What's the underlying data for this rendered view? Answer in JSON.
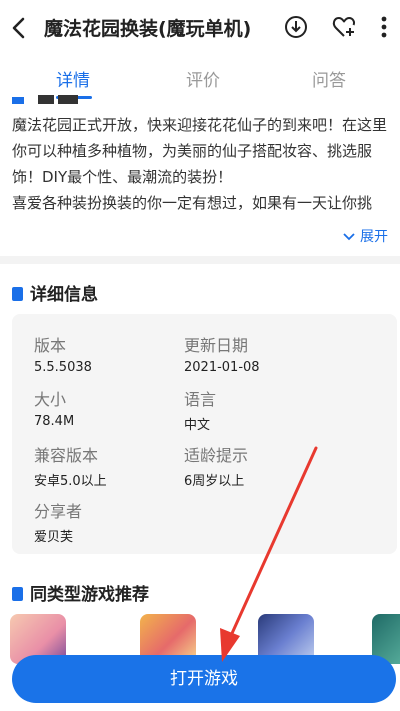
{
  "header": {
    "title": "魔法花园换装(魔玩单机)",
    "icons": [
      "back-icon",
      "download-icon",
      "favorite-add-icon",
      "more-icon"
    ]
  },
  "tabs": [
    {
      "label": "详情",
      "active": true
    },
    {
      "label": "评价",
      "active": false
    },
    {
      "label": "问答",
      "active": false
    }
  ],
  "description": {
    "lines": [
      "魔法花园正式开放，快来迎接花花仙子的到来吧！在这里你可以种植多种植物，为美丽的仙子搭配妆容、挑选服饰！DIY最个性、最潮流的装扮！",
      "喜爱各种装扮换装的你一定有想过，如果有一天让你挑"
    ],
    "expand_label": "展开"
  },
  "details": {
    "title": "详细信息",
    "items": [
      {
        "key": "版本",
        "value": "5.5.5038"
      },
      {
        "key": "更新日期",
        "value": "2021-01-08"
      },
      {
        "key": "大小",
        "value": "78.4M"
      },
      {
        "key": "语言",
        "value": "中文"
      },
      {
        "key": "兼容版本",
        "value": "安卓5.0以上"
      },
      {
        "key": "适龄提示",
        "value": "6周岁以上"
      },
      {
        "key": "分享者",
        "value": "爱贝芙"
      }
    ]
  },
  "recommend": {
    "title": "同类型游戏推荐"
  },
  "cta": {
    "label": "打开游戏"
  },
  "colors": {
    "accent": "#1a6fe8",
    "annotation_arrow": "#e8392f"
  }
}
